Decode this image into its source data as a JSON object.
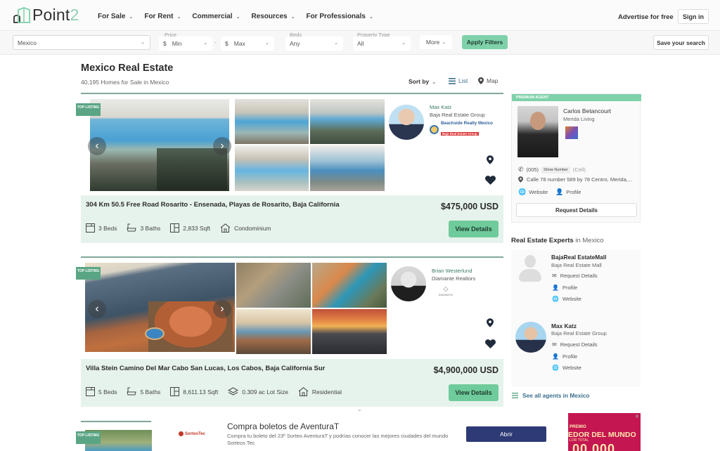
{
  "brand": {
    "name_main": "Point",
    "name_accent": "2",
    "accent_color": "#7fd1aa"
  },
  "nav": {
    "items": [
      "For Sale",
      "For Rent",
      "Commercial",
      "Resources",
      "For Professionals"
    ],
    "advertise": "Advertise for free",
    "sign_in": "Sign in"
  },
  "filters": {
    "location": "Mexico",
    "price_label": "Price",
    "currency": "$",
    "min": "Min",
    "separator": "-",
    "max": "Max",
    "beds_label": "Beds",
    "beds": "Any",
    "type_label": "Property Type",
    "type": "All",
    "more": "More",
    "apply": "Apply Filters",
    "save_search": "Save your search"
  },
  "page": {
    "title": "Mexico Real Estate",
    "subtitle": "40,195 Homes for Sale in Mexico",
    "sort_by": "Sort by",
    "list": "List",
    "map": "Map"
  },
  "listings": [
    {
      "badge": "TOP LISTING",
      "agent_name": "Max Katz",
      "agent_company": "Baja Real Estate Group",
      "agent_logo_line1": "Beachside Realty Mexico",
      "agent_logo_line2": "Baja Real Estate Group",
      "address": "304 Km 50.5 Free Road Rosarito - Ensenada, Playas de Rosarito, Baja California",
      "price": "$475,000 USD",
      "beds": "3 Beds",
      "baths": "3 Baths",
      "sqft": "2,833 Sqft",
      "type": "Condominium",
      "view": "View Details"
    },
    {
      "badge": "TOP LISTING",
      "agent_name": "Brian Westerlund",
      "agent_company": "Diamante Realtors",
      "agent_logo_line1": "DIAMANTE",
      "address": "Villa Stein Camino Del Mar Cabo San Lucas, Los Cabos, Baja California Sur",
      "price": "$4,900,000 USD",
      "beds": "5 Beds",
      "baths": "5 Baths",
      "sqft": "8,611.13 Sqft",
      "lot": "0.309 ac Lot Size",
      "type": "Residential",
      "view": "View Details"
    },
    {
      "badge": "TOP LISTING"
    }
  ],
  "premium_agent": {
    "label": "PREMIUM AGENT",
    "name": "Carlos Betancourt",
    "company": "Merida Living",
    "phone": "(005)",
    "show_number": "Show Number",
    "phone_type": "(Cell)",
    "address": "Calle 78 number 589 by 78 Centro, Merida,...",
    "website": "Website",
    "profile": "Profile",
    "request": "Request Details"
  },
  "experts": {
    "title": "Real Estate Experts",
    "title_suffix": "in Mexico",
    "agents": [
      {
        "name": "BajaReal EstateMall",
        "company": "Baja Real Estate Mall",
        "request": "Request Details",
        "profile": "Profile",
        "website": "Website"
      },
      {
        "name": "Max Katz",
        "company": "Baja Real Estate Group",
        "request": "Request Details",
        "profile": "Profile",
        "website": "Website"
      }
    ],
    "see_all": "See all agents in Mexico"
  },
  "ad": {
    "brand": "SorteoTec",
    "title": "Compra boletos de AventuraT",
    "body": "Compra tu boleto del 23º Sorteo AventuraT y podrías conocer las mejores ciudades del mundo Sorteos Tec",
    "button": "Abrir"
  },
  "ad2": {
    "line1": "PREMIO",
    "line2": "EDOR DEL MUNDO",
    "line3": "LOR TOTAL",
    "line4": "00,000"
  }
}
